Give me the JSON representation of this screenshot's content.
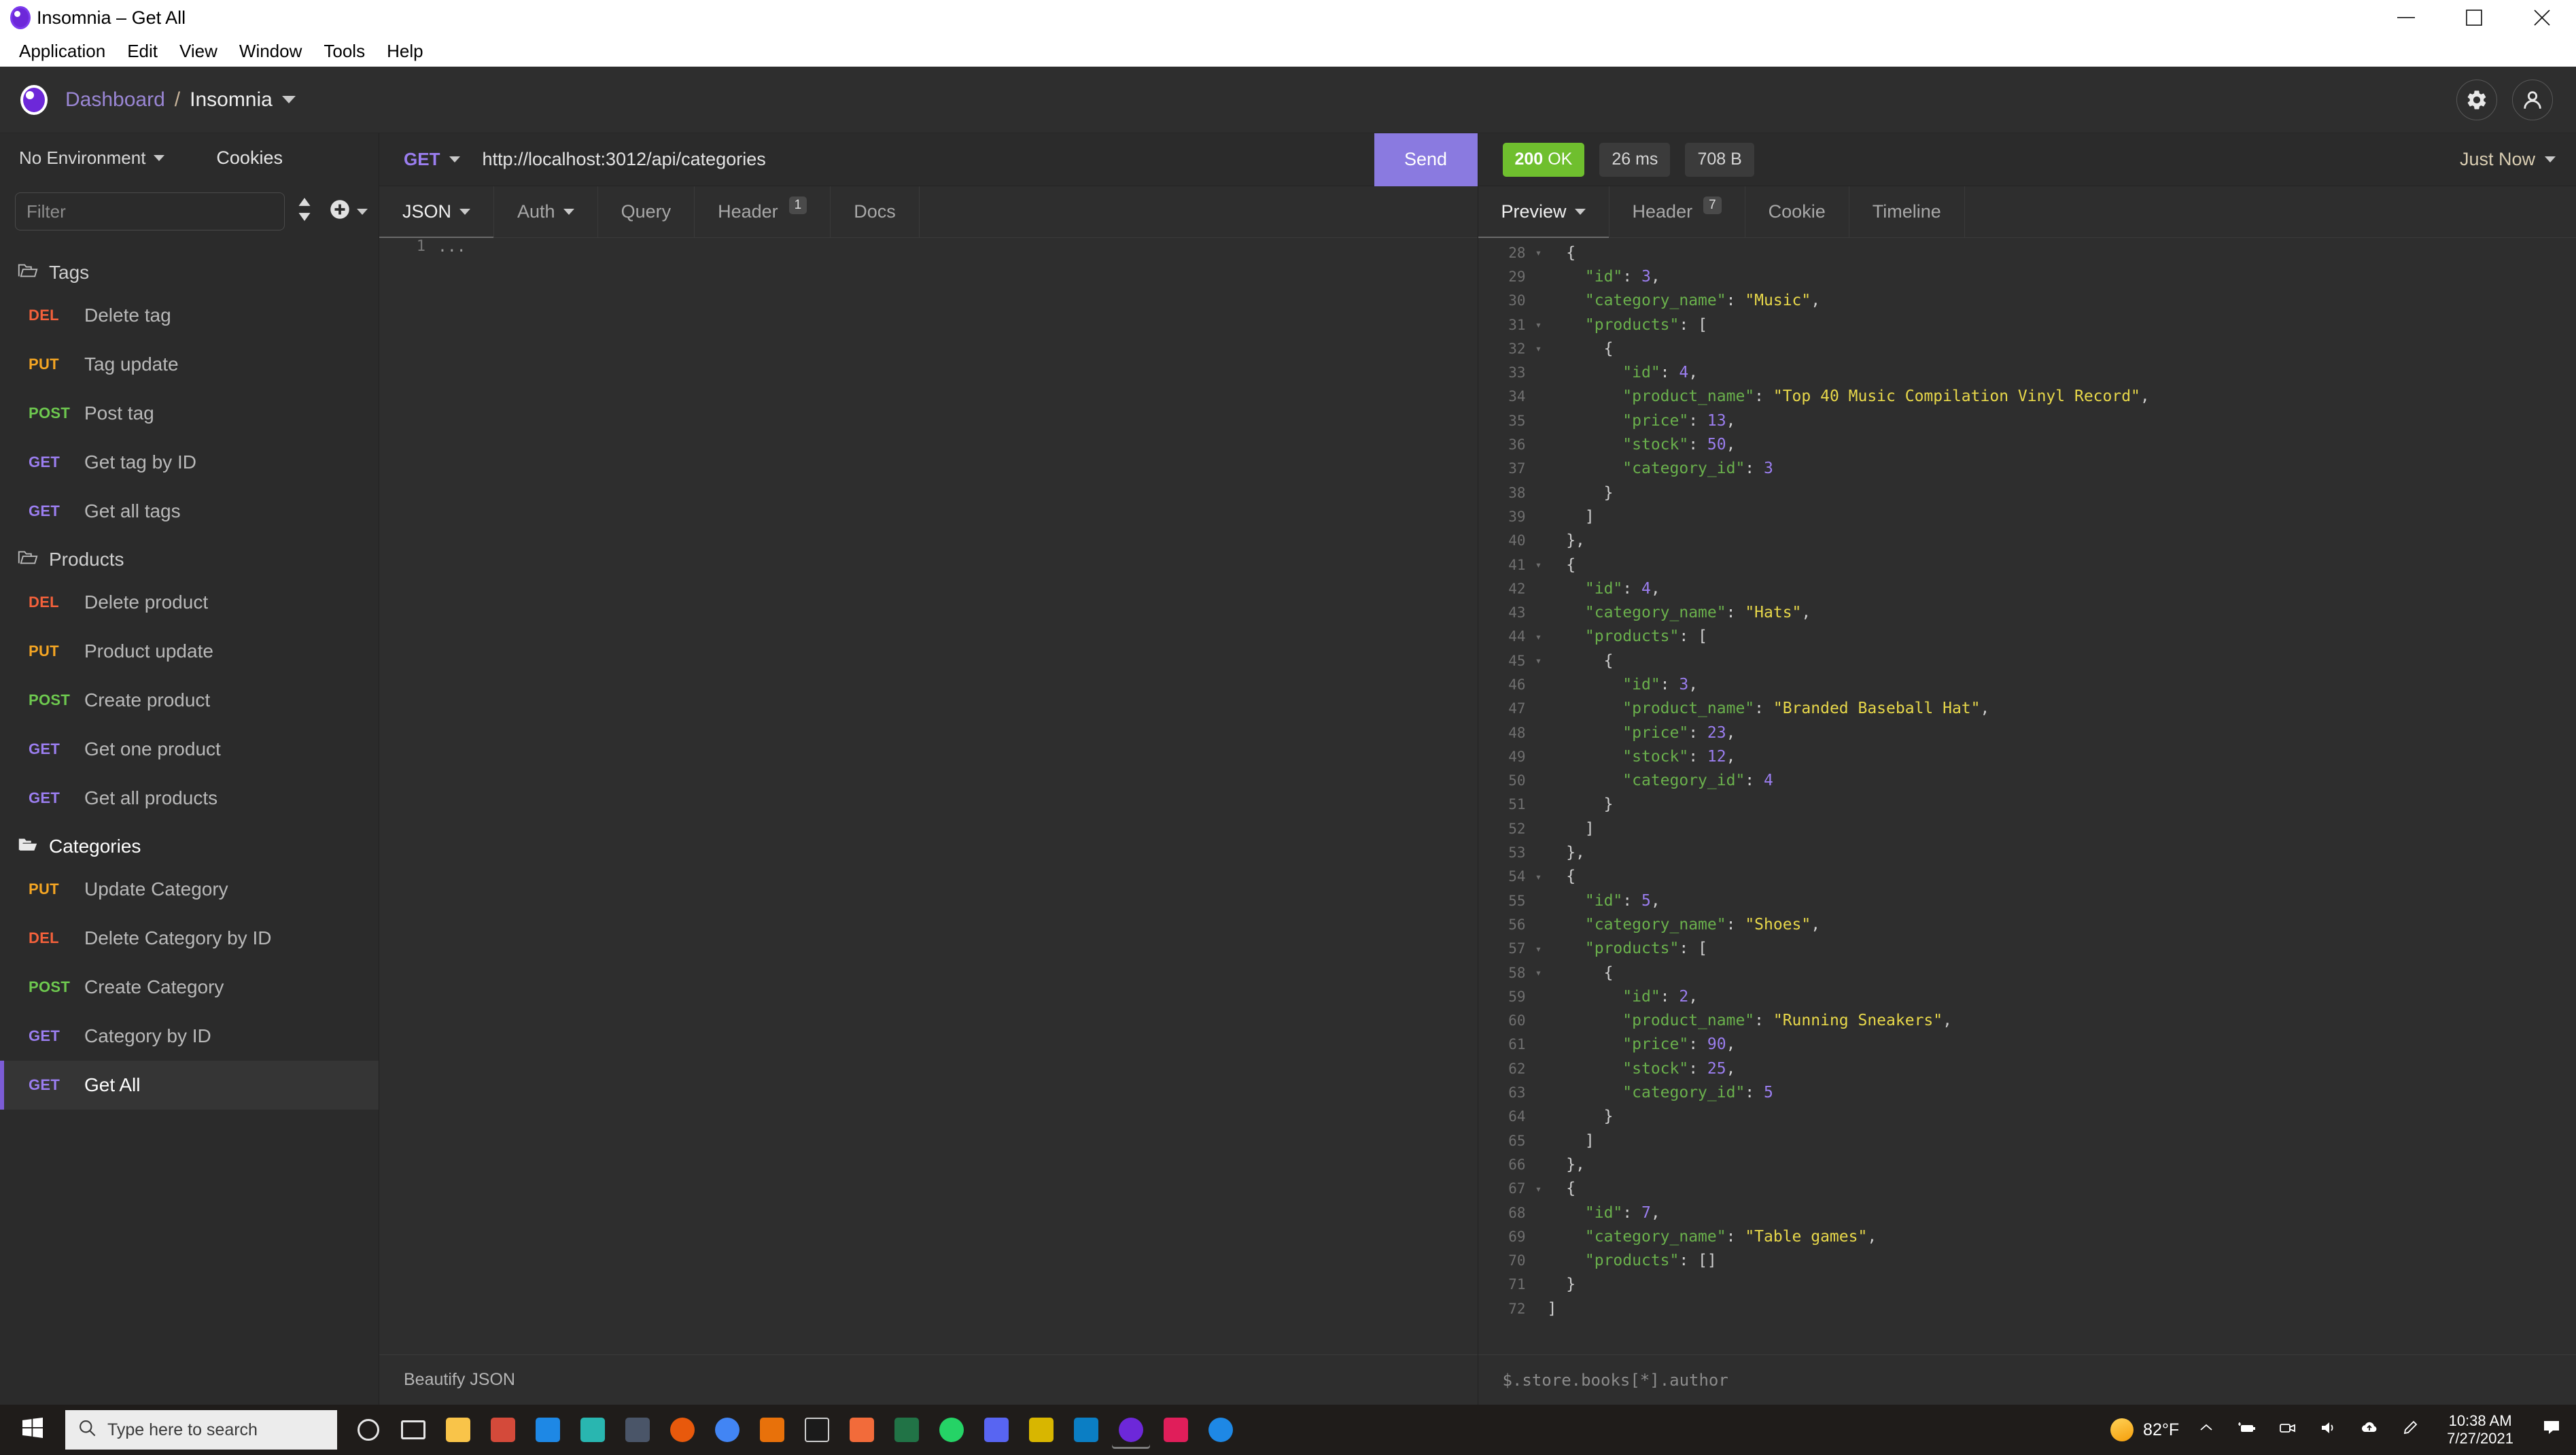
{
  "window": {
    "title": "Insomnia – Get All",
    "controls": {
      "minimize": "minimize-icon",
      "maximize": "maximize-icon",
      "close": "close-icon"
    }
  },
  "menubar": {
    "items": [
      "Application",
      "Edit",
      "View",
      "Window",
      "Tools",
      "Help"
    ]
  },
  "header": {
    "breadcrumb_root": "Dashboard",
    "breadcrumb_sep": "/",
    "breadcrumb_current": "Insomnia",
    "settings_icon": "gear-icon",
    "account_icon": "account-icon"
  },
  "sidebar": {
    "environment": "No Environment",
    "cookies": "Cookies",
    "filter_placeholder": "Filter",
    "sort_icon": "sort-icon",
    "add_icon": "plus-circle-icon",
    "folders": [
      {
        "name": "Tags",
        "open": false,
        "requests": [
          {
            "method": "DEL",
            "name": "Delete tag",
            "selected": false
          },
          {
            "method": "PUT",
            "name": "Tag update",
            "selected": false
          },
          {
            "method": "POST",
            "name": "Post tag",
            "selected": false
          },
          {
            "method": "GET",
            "name": "Get tag by ID",
            "selected": false
          },
          {
            "method": "GET",
            "name": "Get all tags",
            "selected": false
          }
        ]
      },
      {
        "name": "Products",
        "open": false,
        "requests": [
          {
            "method": "DEL",
            "name": "Delete product",
            "selected": false
          },
          {
            "method": "PUT",
            "name": "Product update",
            "selected": false
          },
          {
            "method": "POST",
            "name": "Create product",
            "selected": false
          },
          {
            "method": "GET",
            "name": "Get one product",
            "selected": false
          },
          {
            "method": "GET",
            "name": "Get all products",
            "selected": false
          }
        ]
      },
      {
        "name": "Categories",
        "open": true,
        "requests": [
          {
            "method": "PUT",
            "name": "Update Category",
            "selected": false
          },
          {
            "method": "DEL",
            "name": "Delete Category by ID",
            "selected": false
          },
          {
            "method": "POST",
            "name": "Create Category",
            "selected": false
          },
          {
            "method": "GET",
            "name": "Category by ID",
            "selected": false
          },
          {
            "method": "GET",
            "name": "Get All",
            "selected": true
          }
        ]
      }
    ]
  },
  "request": {
    "method": "GET",
    "url": "http://localhost:3012/api/categories",
    "send_label": "Send",
    "tabs": [
      {
        "label": "JSON",
        "active": true,
        "dropdown": true,
        "badge": null
      },
      {
        "label": "Auth",
        "active": false,
        "dropdown": true,
        "badge": null
      },
      {
        "label": "Query",
        "active": false,
        "dropdown": false,
        "badge": null
      },
      {
        "label": "Header",
        "active": false,
        "dropdown": false,
        "badge": "1"
      },
      {
        "label": "Docs",
        "active": false,
        "dropdown": false,
        "badge": null
      }
    ],
    "body_lines": [
      {
        "num": "1",
        "text": "..."
      }
    ],
    "beautify_label": "Beautify JSON"
  },
  "response": {
    "status_code": "200",
    "status_text": "OK",
    "time": "26 ms",
    "size": "708 B",
    "timestamp_label": "Just Now",
    "tabs": [
      {
        "label": "Preview",
        "active": true,
        "dropdown": true,
        "badge": null
      },
      {
        "label": "Header",
        "active": false,
        "dropdown": false,
        "badge": "7"
      },
      {
        "label": "Cookie",
        "active": false,
        "dropdown": false,
        "badge": null
      },
      {
        "label": "Timeline",
        "active": false,
        "dropdown": false,
        "badge": null
      }
    ],
    "filter_placeholder": "$.store.books[*].author",
    "json_lines": [
      {
        "num": "28",
        "fold": true,
        "indent": 1,
        "tokens": [
          {
            "t": "p",
            "v": "{"
          }
        ]
      },
      {
        "num": "29",
        "fold": false,
        "indent": 2,
        "tokens": [
          {
            "t": "k",
            "v": "\"id\""
          },
          {
            "t": "p",
            "v": ": "
          },
          {
            "t": "n",
            "v": "3"
          },
          {
            "t": "p",
            "v": ","
          }
        ]
      },
      {
        "num": "30",
        "fold": false,
        "indent": 2,
        "tokens": [
          {
            "t": "k",
            "v": "\"category_name\""
          },
          {
            "t": "p",
            "v": ": "
          },
          {
            "t": "s",
            "v": "\"Music\""
          },
          {
            "t": "p",
            "v": ","
          }
        ]
      },
      {
        "num": "31",
        "fold": true,
        "indent": 2,
        "tokens": [
          {
            "t": "k",
            "v": "\"products\""
          },
          {
            "t": "p",
            "v": ": ["
          }
        ]
      },
      {
        "num": "32",
        "fold": true,
        "indent": 3,
        "tokens": [
          {
            "t": "p",
            "v": "{"
          }
        ]
      },
      {
        "num": "33",
        "fold": false,
        "indent": 4,
        "tokens": [
          {
            "t": "k",
            "v": "\"id\""
          },
          {
            "t": "p",
            "v": ": "
          },
          {
            "t": "n",
            "v": "4"
          },
          {
            "t": "p",
            "v": ","
          }
        ]
      },
      {
        "num": "34",
        "fold": false,
        "indent": 4,
        "tokens": [
          {
            "t": "k",
            "v": "\"product_name\""
          },
          {
            "t": "p",
            "v": ": "
          },
          {
            "t": "s",
            "v": "\"Top 40 Music Compilation Vinyl Record\""
          },
          {
            "t": "p",
            "v": ","
          }
        ]
      },
      {
        "num": "35",
        "fold": false,
        "indent": 4,
        "tokens": [
          {
            "t": "k",
            "v": "\"price\""
          },
          {
            "t": "p",
            "v": ": "
          },
          {
            "t": "n",
            "v": "13"
          },
          {
            "t": "p",
            "v": ","
          }
        ]
      },
      {
        "num": "36",
        "fold": false,
        "indent": 4,
        "tokens": [
          {
            "t": "k",
            "v": "\"stock\""
          },
          {
            "t": "p",
            "v": ": "
          },
          {
            "t": "n",
            "v": "50"
          },
          {
            "t": "p",
            "v": ","
          }
        ]
      },
      {
        "num": "37",
        "fold": false,
        "indent": 4,
        "tokens": [
          {
            "t": "k",
            "v": "\"category_id\""
          },
          {
            "t": "p",
            "v": ": "
          },
          {
            "t": "n",
            "v": "3"
          }
        ]
      },
      {
        "num": "38",
        "fold": false,
        "indent": 3,
        "tokens": [
          {
            "t": "p",
            "v": "}"
          }
        ]
      },
      {
        "num": "39",
        "fold": false,
        "indent": 2,
        "tokens": [
          {
            "t": "p",
            "v": "]"
          }
        ]
      },
      {
        "num": "40",
        "fold": false,
        "indent": 1,
        "tokens": [
          {
            "t": "p",
            "v": "},"
          }
        ]
      },
      {
        "num": "41",
        "fold": true,
        "indent": 1,
        "tokens": [
          {
            "t": "p",
            "v": "{"
          }
        ]
      },
      {
        "num": "42",
        "fold": false,
        "indent": 2,
        "tokens": [
          {
            "t": "k",
            "v": "\"id\""
          },
          {
            "t": "p",
            "v": ": "
          },
          {
            "t": "n",
            "v": "4"
          },
          {
            "t": "p",
            "v": ","
          }
        ]
      },
      {
        "num": "43",
        "fold": false,
        "indent": 2,
        "tokens": [
          {
            "t": "k",
            "v": "\"category_name\""
          },
          {
            "t": "p",
            "v": ": "
          },
          {
            "t": "s",
            "v": "\"Hats\""
          },
          {
            "t": "p",
            "v": ","
          }
        ]
      },
      {
        "num": "44",
        "fold": true,
        "indent": 2,
        "tokens": [
          {
            "t": "k",
            "v": "\"products\""
          },
          {
            "t": "p",
            "v": ": ["
          }
        ]
      },
      {
        "num": "45",
        "fold": true,
        "indent": 3,
        "tokens": [
          {
            "t": "p",
            "v": "{"
          }
        ]
      },
      {
        "num": "46",
        "fold": false,
        "indent": 4,
        "tokens": [
          {
            "t": "k",
            "v": "\"id\""
          },
          {
            "t": "p",
            "v": ": "
          },
          {
            "t": "n",
            "v": "3"
          },
          {
            "t": "p",
            "v": ","
          }
        ]
      },
      {
        "num": "47",
        "fold": false,
        "indent": 4,
        "tokens": [
          {
            "t": "k",
            "v": "\"product_name\""
          },
          {
            "t": "p",
            "v": ": "
          },
          {
            "t": "s",
            "v": "\"Branded Baseball Hat\""
          },
          {
            "t": "p",
            "v": ","
          }
        ]
      },
      {
        "num": "48",
        "fold": false,
        "indent": 4,
        "tokens": [
          {
            "t": "k",
            "v": "\"price\""
          },
          {
            "t": "p",
            "v": ": "
          },
          {
            "t": "n",
            "v": "23"
          },
          {
            "t": "p",
            "v": ","
          }
        ]
      },
      {
        "num": "49",
        "fold": false,
        "indent": 4,
        "tokens": [
          {
            "t": "k",
            "v": "\"stock\""
          },
          {
            "t": "p",
            "v": ": "
          },
          {
            "t": "n",
            "v": "12"
          },
          {
            "t": "p",
            "v": ","
          }
        ]
      },
      {
        "num": "50",
        "fold": false,
        "indent": 4,
        "tokens": [
          {
            "t": "k",
            "v": "\"category_id\""
          },
          {
            "t": "p",
            "v": ": "
          },
          {
            "t": "n",
            "v": "4"
          }
        ]
      },
      {
        "num": "51",
        "fold": false,
        "indent": 3,
        "tokens": [
          {
            "t": "p",
            "v": "}"
          }
        ]
      },
      {
        "num": "52",
        "fold": false,
        "indent": 2,
        "tokens": [
          {
            "t": "p",
            "v": "]"
          }
        ]
      },
      {
        "num": "53",
        "fold": false,
        "indent": 1,
        "tokens": [
          {
            "t": "p",
            "v": "},"
          }
        ]
      },
      {
        "num": "54",
        "fold": true,
        "indent": 1,
        "tokens": [
          {
            "t": "p",
            "v": "{"
          }
        ]
      },
      {
        "num": "55",
        "fold": false,
        "indent": 2,
        "tokens": [
          {
            "t": "k",
            "v": "\"id\""
          },
          {
            "t": "p",
            "v": ": "
          },
          {
            "t": "n",
            "v": "5"
          },
          {
            "t": "p",
            "v": ","
          }
        ]
      },
      {
        "num": "56",
        "fold": false,
        "indent": 2,
        "tokens": [
          {
            "t": "k",
            "v": "\"category_name\""
          },
          {
            "t": "p",
            "v": ": "
          },
          {
            "t": "s",
            "v": "\"Shoes\""
          },
          {
            "t": "p",
            "v": ","
          }
        ]
      },
      {
        "num": "57",
        "fold": true,
        "indent": 2,
        "tokens": [
          {
            "t": "k",
            "v": "\"products\""
          },
          {
            "t": "p",
            "v": ": ["
          }
        ]
      },
      {
        "num": "58",
        "fold": true,
        "indent": 3,
        "tokens": [
          {
            "t": "p",
            "v": "{"
          }
        ]
      },
      {
        "num": "59",
        "fold": false,
        "indent": 4,
        "tokens": [
          {
            "t": "k",
            "v": "\"id\""
          },
          {
            "t": "p",
            "v": ": "
          },
          {
            "t": "n",
            "v": "2"
          },
          {
            "t": "p",
            "v": ","
          }
        ]
      },
      {
        "num": "60",
        "fold": false,
        "indent": 4,
        "tokens": [
          {
            "t": "k",
            "v": "\"product_name\""
          },
          {
            "t": "p",
            "v": ": "
          },
          {
            "t": "s",
            "v": "\"Running Sneakers\""
          },
          {
            "t": "p",
            "v": ","
          }
        ]
      },
      {
        "num": "61",
        "fold": false,
        "indent": 4,
        "tokens": [
          {
            "t": "k",
            "v": "\"price\""
          },
          {
            "t": "p",
            "v": ": "
          },
          {
            "t": "n",
            "v": "90"
          },
          {
            "t": "p",
            "v": ","
          }
        ]
      },
      {
        "num": "62",
        "fold": false,
        "indent": 4,
        "tokens": [
          {
            "t": "k",
            "v": "\"stock\""
          },
          {
            "t": "p",
            "v": ": "
          },
          {
            "t": "n",
            "v": "25"
          },
          {
            "t": "p",
            "v": ","
          }
        ]
      },
      {
        "num": "63",
        "fold": false,
        "indent": 4,
        "tokens": [
          {
            "t": "k",
            "v": "\"category_id\""
          },
          {
            "t": "p",
            "v": ": "
          },
          {
            "t": "n",
            "v": "5"
          }
        ]
      },
      {
        "num": "64",
        "fold": false,
        "indent": 3,
        "tokens": [
          {
            "t": "p",
            "v": "}"
          }
        ]
      },
      {
        "num": "65",
        "fold": false,
        "indent": 2,
        "tokens": [
          {
            "t": "p",
            "v": "]"
          }
        ]
      },
      {
        "num": "66",
        "fold": false,
        "indent": 1,
        "tokens": [
          {
            "t": "p",
            "v": "},"
          }
        ]
      },
      {
        "num": "67",
        "fold": true,
        "indent": 1,
        "tokens": [
          {
            "t": "p",
            "v": "{"
          }
        ]
      },
      {
        "num": "68",
        "fold": false,
        "indent": 2,
        "tokens": [
          {
            "t": "k",
            "v": "\"id\""
          },
          {
            "t": "p",
            "v": ": "
          },
          {
            "t": "n",
            "v": "7"
          },
          {
            "t": "p",
            "v": ","
          }
        ]
      },
      {
        "num": "69",
        "fold": false,
        "indent": 2,
        "tokens": [
          {
            "t": "k",
            "v": "\"category_name\""
          },
          {
            "t": "p",
            "v": ": "
          },
          {
            "t": "s",
            "v": "\"Table games\""
          },
          {
            "t": "p",
            "v": ","
          }
        ]
      },
      {
        "num": "70",
        "fold": false,
        "indent": 2,
        "tokens": [
          {
            "t": "k",
            "v": "\"products\""
          },
          {
            "t": "p",
            "v": ": []"
          }
        ]
      },
      {
        "num": "71",
        "fold": false,
        "indent": 1,
        "tokens": [
          {
            "t": "p",
            "v": "}"
          }
        ]
      },
      {
        "num": "72",
        "fold": false,
        "indent": 0,
        "tokens": [
          {
            "t": "p",
            "v": "]"
          }
        ]
      }
    ]
  },
  "taskbar": {
    "start_icon": "windows-start-icon",
    "search_placeholder": "Type here to search",
    "search_icon": "search-icon",
    "apps": [
      {
        "name": "cortana-icon",
        "color": "#1b1b1b"
      },
      {
        "name": "task-view-icon",
        "color": "#1b1b1b"
      },
      {
        "name": "file-explorer-icon",
        "color": "#f9c449"
      },
      {
        "name": "microsoft-store-icon",
        "color": "#d44a3a"
      },
      {
        "name": "mail-icon",
        "color": "#1e88e5"
      },
      {
        "name": "insomnia-icon",
        "color": "#29b6b0"
      },
      {
        "name": "app-icon",
        "color": "#4a5568"
      },
      {
        "name": "firefox-icon",
        "color": "#e8590c"
      },
      {
        "name": "chrome-icon",
        "color": "#4285f4"
      },
      {
        "name": "vlc-icon",
        "color": "#e8710a"
      },
      {
        "name": "terminal-icon",
        "color": "#1b1b1b"
      },
      {
        "name": "postman-icon",
        "color": "#f26b3a"
      },
      {
        "name": "excel-icon",
        "color": "#217346"
      },
      {
        "name": "whatsapp-icon",
        "color": "#25d366"
      },
      {
        "name": "discord-icon",
        "color": "#5865f2"
      },
      {
        "name": "sublime-icon",
        "color": "#d8b600"
      },
      {
        "name": "vscode-icon",
        "color": "#0b7ec4"
      },
      {
        "name": "insomnia-app-icon",
        "color": "#6d28d9"
      },
      {
        "name": "slack-icon",
        "color": "#e01e5a"
      },
      {
        "name": "help-icon",
        "color": "#1e88e5"
      }
    ],
    "weather_temp": "82°F",
    "weather_icon": "sun-icon",
    "tray_icons": [
      "chevron-up-icon",
      "battery-charging-icon",
      "camera-icon",
      "volume-icon",
      "cloud-upload-icon",
      "pen-icon"
    ],
    "clock_time": "10:38 AM",
    "clock_date": "7/27/2021",
    "notification_icon": "notifications-icon"
  }
}
